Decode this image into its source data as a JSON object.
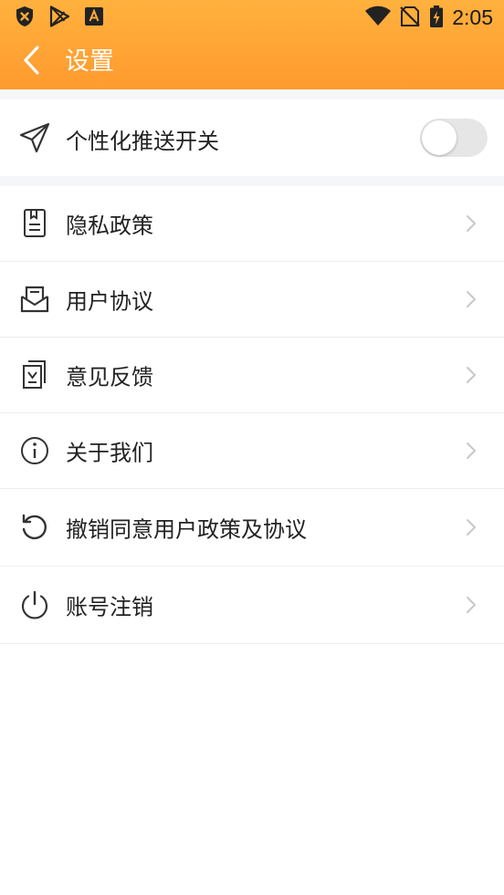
{
  "status_bar": {
    "time": "2:05",
    "left_icons": [
      "shield-x-icon",
      "play-store-icon",
      "font-app-icon"
    ],
    "right_icons": [
      "wifi-icon",
      "no-sim-icon",
      "battery-charging-icon"
    ]
  },
  "header": {
    "title": "设置",
    "back_icon": "back-arrow-icon",
    "gradient_top": "#ffb13e",
    "gradient_bottom": "#ff9a2e"
  },
  "push_setting": {
    "label": "个性化推送开关",
    "icon": "send-icon",
    "enabled": false
  },
  "menu": {
    "items": [
      {
        "label": "隐私政策",
        "icon": "privacy-document-icon"
      },
      {
        "label": "用户协议",
        "icon": "envelope-agreement-icon"
      },
      {
        "label": "意见反馈",
        "icon": "feedback-icon"
      },
      {
        "label": "关于我们",
        "icon": "info-icon"
      },
      {
        "label": "撤销同意用户政策及协议",
        "icon": "revoke-icon"
      },
      {
        "label": "账号注销",
        "icon": "power-icon"
      }
    ]
  },
  "colors": {
    "divider_gap": "#f5f6fa",
    "chevron": "#c8c8c8",
    "icon_stroke": "#333333"
  }
}
